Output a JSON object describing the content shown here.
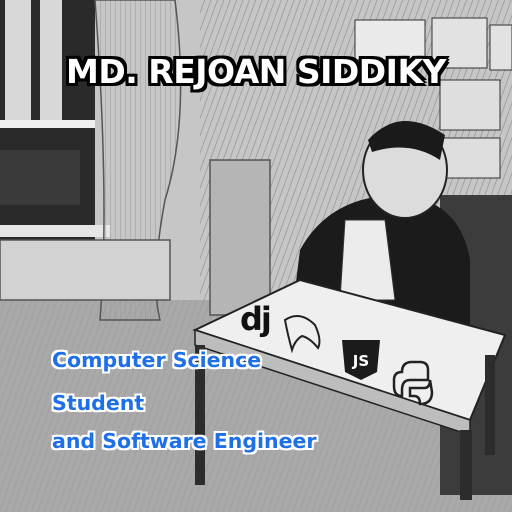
{
  "banner": {
    "name": "MD. REJOAN SIDDIKY",
    "tagline": [
      "Computer Science",
      "Student",
      "and Software Engineer"
    ]
  },
  "desk_logos": {
    "django": "dj",
    "javascript": "JS"
  },
  "icons": [
    "django-logo-icon",
    "mysql-dolphin-icon",
    "javascript-shield-icon",
    "python-logo-icon"
  ],
  "colors": {
    "title_text": "#ffffff",
    "tagline_text": "#1f6fe6"
  }
}
